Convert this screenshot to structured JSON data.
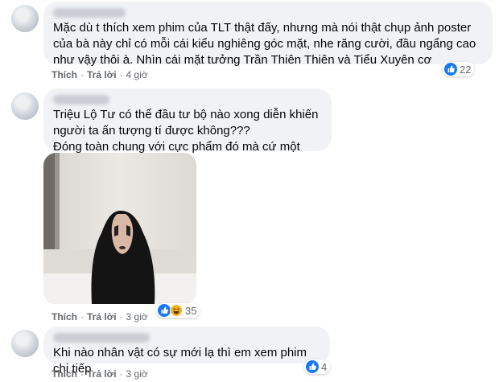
{
  "comments": [
    {
      "text": "Mặc dù t thích xem phim của TLT thật đấy, nhưng mà nói thật chụp ảnh poster của bà này chỉ có mỗi cái kiểu nghiêng góc mặt, nhe răng cười, đầu ngẩng cao như vậy thôi à. Nhìn cái mặt tưởng Trần Thiên Thiên và Tiểu Xuyên cơ",
      "like_label": "Thích",
      "reply_label": "Trả lời",
      "time": "4 giờ",
      "reaction_count": "22",
      "reaction_icons": [
        "like-icon"
      ]
    },
    {
      "text": "Triệu Lộ Tư có thể đầu tư bộ nào xong diễn khiến người ta ấn tượng tí được không???\nĐóng toàn chung với cực phẩm đó mà cứ một màu dễ sợ",
      "like_label": "Thích",
      "reply_label": "Trả lời",
      "time": "3 giờ",
      "reaction_count": "35",
      "reaction_icons": [
        "like-icon",
        "haha-icon"
      ]
    },
    {
      "text": "Khi nào nhân vật có sự mới lạ thì em xem phim chị tiếp",
      "like_label": "Thích",
      "reply_label": "Trả lời",
      "time": "3 giờ",
      "reaction_count": "4",
      "reaction_icons": [
        "like-icon"
      ]
    }
  ],
  "separator": "·",
  "colors": {
    "bubble": "#f0f2f5",
    "like": "#1877f2",
    "haha": "#f7b125",
    "meta": "#65676b"
  }
}
